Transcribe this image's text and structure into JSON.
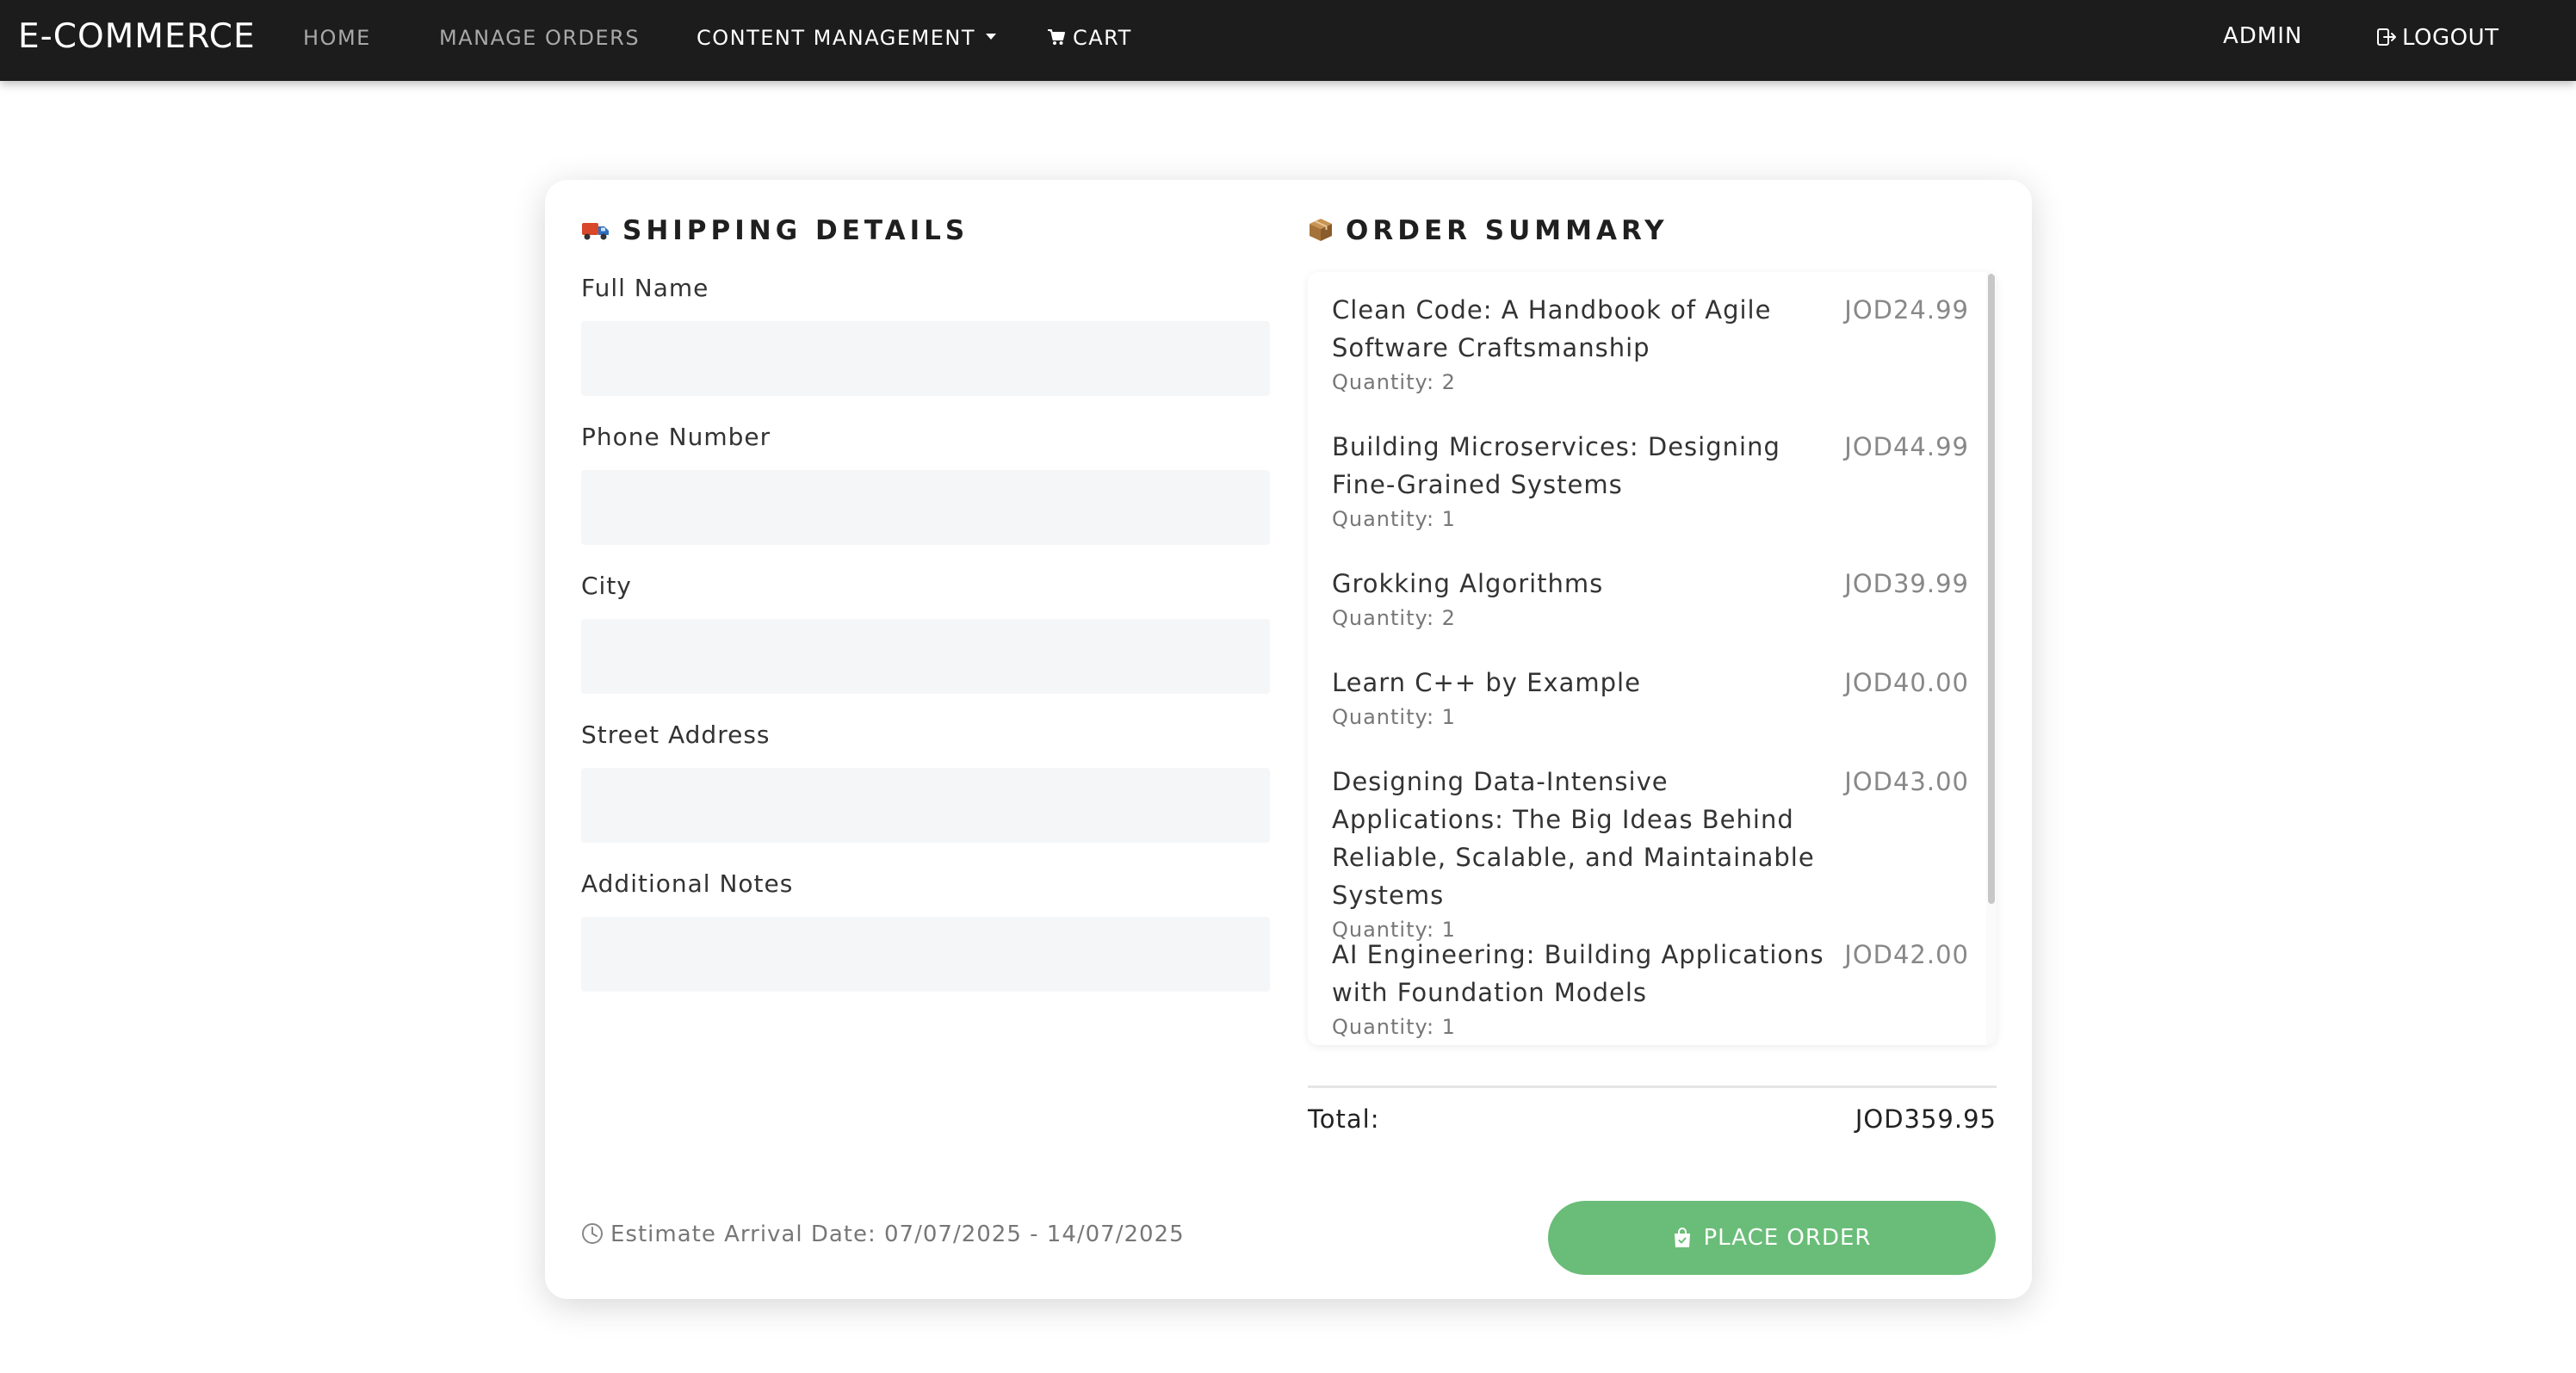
{
  "navbar": {
    "brand": "E-COMMERCE",
    "links": {
      "home": "HOME",
      "manage_orders": "MANAGE ORDERS",
      "content_management": "CONTENT MANAGEMENT",
      "cart": "CART"
    },
    "user": "ADMIN",
    "logout": "LOGOUT"
  },
  "shipping": {
    "title": "SHIPPING DETAILS",
    "icon": "truck-icon",
    "fields": {
      "full_name": {
        "label": "Full Name",
        "value": "",
        "placeholder": ""
      },
      "phone": {
        "label": "Phone Number",
        "value": "",
        "placeholder": ""
      },
      "city": {
        "label": "City",
        "value": "",
        "placeholder": ""
      },
      "street": {
        "label": "Street Address",
        "value": "",
        "placeholder": ""
      },
      "notes": {
        "label": "Additional Notes",
        "value": "",
        "placeholder": ""
      }
    },
    "estimate": "Estimate Arrival Date: 07/07/2025 - 14/07/2025"
  },
  "summary": {
    "title": "ORDER SUMMARY",
    "icon": "package-icon",
    "items": [
      {
        "name": "Clean Code: A Handbook of Agile Software Craftsmanship",
        "price": "JOD24.99",
        "qty": "Quantity: 2"
      },
      {
        "name": "Building Microservices: Designing Fine-Grained Systems",
        "price": "JOD44.99",
        "qty": "Quantity: 1"
      },
      {
        "name": "Grokking Algorithms",
        "price": "JOD39.99",
        "qty": "Quantity: 2"
      },
      {
        "name": "Learn C++ by Example",
        "price": "JOD40.00",
        "qty": "Quantity: 1"
      },
      {
        "name": "Designing Data-Intensive Applications: The Big Ideas Behind Reliable, Scalable, and Maintainable Systems",
        "price": "JOD43.00",
        "qty": "Quantity: 1"
      },
      {
        "name": "AI Engineering: Building Applications with Foundation Models",
        "price": "JOD42.00",
        "qty": "Quantity: 1"
      }
    ],
    "total_label": "Total:",
    "total_value": "JOD359.95"
  },
  "actions": {
    "place_order": "PLACE ORDER"
  },
  "colors": {
    "navbar_bg": "#1c1c1c",
    "accent_green": "#6abd78",
    "input_bg": "#f5f6f8"
  }
}
